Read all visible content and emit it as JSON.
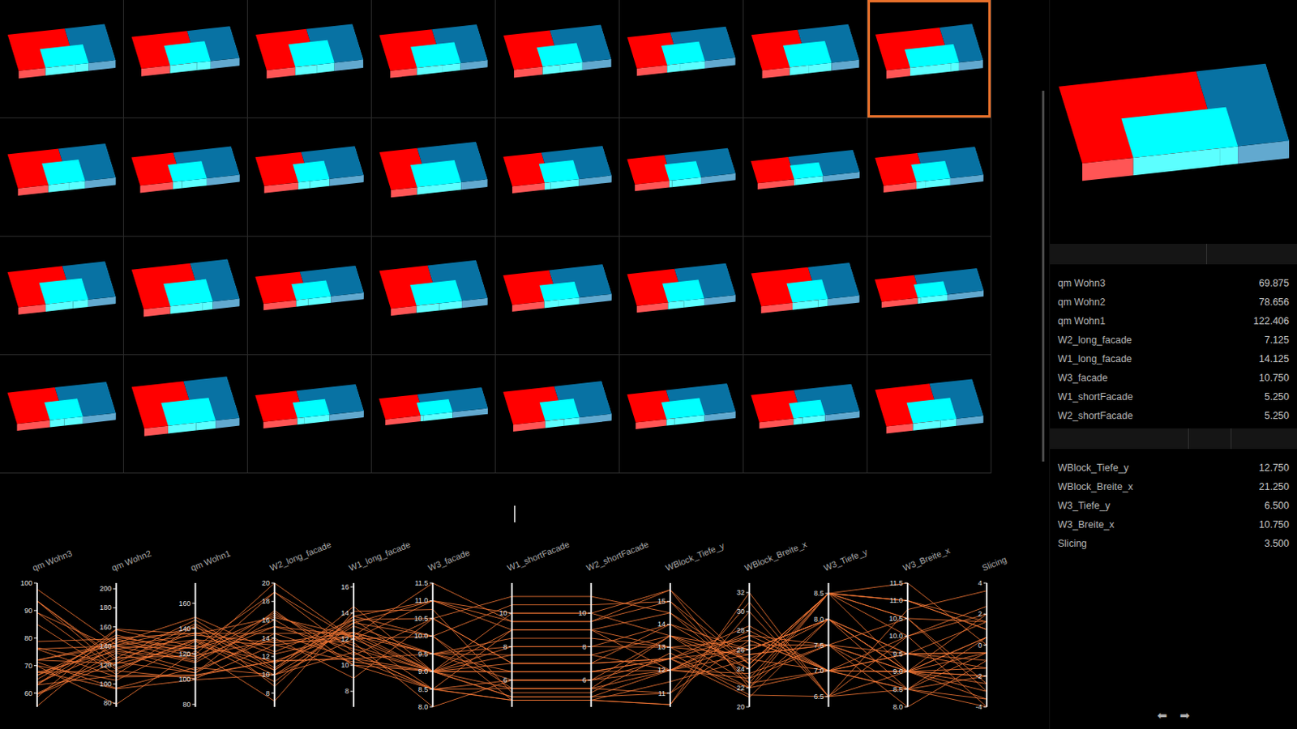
{
  "designs": [
    {
      "selected": false,
      "values": [
        70,
        103.9,
        129.9,
        9.25,
        13.25,
        10,
        5.5,
        5.5,
        13.5,
        22.5,
        7,
        10,
        2
      ]
    },
    {
      "selected": false,
      "values": [
        71.25,
        95.6,
        109.1,
        10,
        13,
        9.5,
        7.5,
        7.5,
        12,
        23,
        7.5,
        9.5,
        1.5
      ]
    },
    {
      "selected": false,
      "values": [
        68,
        95,
        99.5,
        10,
        11,
        8.5,
        6,
        6,
        12.5,
        21,
        8,
        8.5,
        0.5
      ]
    },
    {
      "selected": false,
      "values": [
        93.5,
        124.8,
        136.9,
        11.25,
        13.25,
        11,
        9,
        9,
        14.5,
        24.5,
        8.5,
        11,
        1
      ]
    },
    {
      "selected": false,
      "values": [
        63,
        108.8,
        103.3,
        11.5,
        10.5,
        9,
        6.5,
        6.5,
        12.5,
        22,
        7,
        9,
        -0.5
      ]
    },
    {
      "selected": false,
      "values": [
        67.5,
        114,
        100.5,
        13.25,
        10.25,
        9,
        5,
        5,
        12,
        23.5,
        7.5,
        9,
        -1.5
      ]
    },
    {
      "selected": false,
      "values": [
        76,
        107.5,
        102.5,
        11.5,
        10.5,
        9.5,
        8,
        8,
        13,
        22,
        8,
        9.5,
        -0.5
      ]
    },
    {
      "selected": true,
      "values": [
        69.875,
        78.656,
        122.406,
        7.125,
        14.125,
        10.75,
        5.25,
        5.25,
        12.75,
        21.25,
        6.5,
        10.75,
        3.5
      ]
    },
    {
      "selected": false,
      "values": [
        76.5,
        121.3,
        126.3,
        11.5,
        12.5,
        9,
        10,
        10,
        13.5,
        24,
        8.5,
        9,
        0.5
      ]
    },
    {
      "selected": false,
      "values": [
        59.5,
        123,
        105,
        14.5,
        10.5,
        8.5,
        4.8,
        4.8,
        11.5,
        25,
        7,
        8.5,
        -2
      ]
    },
    {
      "selected": false,
      "values": [
        60,
        127.5,
        118.5,
        13.75,
        11.75,
        8,
        6,
        6,
        12,
        25.5,
        7.5,
        8,
        -1
      ]
    },
    {
      "selected": false,
      "values": [
        89.25,
        137.1,
        107.1,
        14,
        9,
        10.5,
        11,
        11,
        14.5,
        23,
        8.5,
        10.5,
        -2.5
      ]
    },
    {
      "selected": false,
      "values": [
        72,
        140,
        113,
        16,
        10,
        9,
        7,
        7,
        12.5,
        26,
        8,
        9,
        -3
      ]
    },
    {
      "selected": false,
      "values": [
        59.5,
        132.7,
        104.8,
        17,
        10,
        8.5,
        5.5,
        5.5,
        11,
        27,
        7,
        8.5,
        -3.5
      ]
    },
    {
      "selected": false,
      "values": [
        55.25,
        145.9,
        113.9,
        19,
        11,
        8.5,
        4.8,
        4.8,
        10.5,
        30,
        6.5,
        8.5,
        -4
      ]
    },
    {
      "selected": false,
      "values": [
        67.5,
        134.3,
        116.2,
        15.25,
        11.25,
        9,
        9,
        9,
        12,
        26.5,
        7.5,
        9,
        -2
      ]
    },
    {
      "selected": false,
      "values": [
        89.25,
        115.1,
        131.6,
        10.5,
        13.5,
        10.5,
        7,
        7,
        14,
        24,
        8.5,
        10.5,
        1.5
      ]
    },
    {
      "selected": false,
      "values": [
        85,
        110,
        142.5,
        8.75,
        13.75,
        10,
        10.5,
        10.5,
        15,
        22.5,
        8.5,
        10,
        2.5
      ]
    },
    {
      "selected": false,
      "values": [
        66.5,
        139.2,
        124.3,
        15.25,
        12.25,
        9.5,
        6.5,
        6.5,
        12,
        27.5,
        7,
        9.5,
        -1.5
      ]
    },
    {
      "selected": false,
      "values": [
        97.75,
        141,
        141,
        12.25,
        12.25,
        11.5,
        9.5,
        9.5,
        15.5,
        24.5,
        8.5,
        11.5,
        0
      ]
    },
    {
      "selected": false,
      "values": [
        66.5,
        148.3,
        136.2,
        14.5,
        12.5,
        9.5,
        8.5,
        8.5,
        13,
        27,
        7,
        9.5,
        -1
      ]
    },
    {
      "selected": false,
      "values": [
        76,
        140.2,
        134.8,
        13.5,
        12.5,
        9.5,
        6,
        6,
        13.5,
        26,
        8,
        9.5,
        -0.5
      ]
    },
    {
      "selected": false,
      "values": [
        72,
        121.8,
        143.8,
        10.5,
        14.5,
        9,
        7.5,
        7.5,
        13.5,
        25,
        8,
        9,
        2
      ]
    },
    {
      "selected": false,
      "values": [
        58.5,
        157,
        125.5,
        19,
        12,
        9,
        5,
        5,
        11,
        31,
        6.5,
        9,
        -3.5
      ]
    },
    {
      "selected": false,
      "values": [
        63.75,
        136.6,
        131.1,
        13.25,
        12.25,
        8.5,
        9,
        9,
        13,
        25.5,
        7.5,
        8.5,
        -0.5
      ]
    },
    {
      "selected": false,
      "values": [
        93.5,
        116.8,
        130.7,
        10,
        12,
        11,
        10,
        10,
        15.5,
        22,
        8.5,
        11,
        1
      ]
    },
    {
      "selected": false,
      "values": [
        63,
        149,
        124,
        16.5,
        11.5,
        9,
        5.5,
        5.5,
        12,
        28,
        7,
        9,
        -2.5
      ]
    },
    {
      "selected": false,
      "values": [
        65,
        151.5,
        119.5,
        20,
        12,
        10,
        4.8,
        4.8,
        10.5,
        32,
        6.5,
        10,
        -4
      ]
    },
    {
      "selected": false,
      "values": [
        72,
        143,
        149,
        12.5,
        13.5,
        9,
        8,
        8,
        14,
        26,
        8,
        9,
        0.5
      ]
    },
    {
      "selected": false,
      "values": [
        78.75,
        147.5,
        117.5,
        16.75,
        10.75,
        10.5,
        7,
        7,
        12.5,
        27.5,
        7.5,
        10.5,
        -3
      ]
    },
    {
      "selected": false,
      "values": [
        63,
        157.6,
        135.6,
        16.25,
        12.25,
        9,
        6.5,
        6.5,
        12.5,
        28.5,
        7,
        9,
        -2
      ]
    },
    {
      "selected": false,
      "values": [
        93.5,
        127.3,
        146.8,
        10.75,
        13.75,
        11,
        9.5,
        9.5,
        15,
        24.5,
        8.5,
        11,
        1.5
      ]
    }
  ],
  "details": {
    "outputs": [
      {
        "label": "qm Wohn3",
        "value": "69.875"
      },
      {
        "label": "qm Wohn2",
        "value": "78.656"
      },
      {
        "label": "qm Wohn1",
        "value": "122.406"
      },
      {
        "label": "W2_long_facade",
        "value": "7.125"
      },
      {
        "label": "W1_long_facade",
        "value": "14.125"
      },
      {
        "label": "W3_facade",
        "value": "10.750"
      },
      {
        "label": "W1_shortFacade",
        "value": "5.250"
      },
      {
        "label": "W2_shortFacade",
        "value": "5.250"
      }
    ],
    "inputs": [
      {
        "label": "WBlock_Tiefe_y",
        "value": "12.750"
      },
      {
        "label": "WBlock_Breite_x",
        "value": "21.250"
      },
      {
        "label": "W3_Tiefe_y",
        "value": "6.500"
      },
      {
        "label": "W3_Breite_x",
        "value": "10.750"
      },
      {
        "label": "Slicing",
        "value": "3.500"
      }
    ]
  },
  "nav": {
    "prev": "⬅",
    "next": "➡"
  },
  "chart": {
    "axes": [
      {
        "label": "qm Wohn3",
        "min": 55,
        "max": 100,
        "ticks": [
          "60",
          "70",
          "80",
          "90",
          "100"
        ]
      },
      {
        "label": "qm Wohn2",
        "min": 76,
        "max": 206,
        "ticks": [
          "80",
          "100",
          "120",
          "140",
          "160",
          "180",
          "200"
        ]
      },
      {
        "label": "qm Wohn1",
        "min": 78,
        "max": 176,
        "ticks": [
          "80",
          "100",
          "120",
          "140",
          "160"
        ]
      },
      {
        "label": "W2_long_facade",
        "min": 6.5,
        "max": 20,
        "ticks": [
          "8",
          "10",
          "12",
          "14",
          "16",
          "18",
          "20"
        ]
      },
      {
        "label": "W1_long_facade",
        "min": 6.8,
        "max": 16.3,
        "ticks": [
          "8",
          "10",
          "12",
          "14",
          "16"
        ]
      },
      {
        "label": "W3_facade",
        "min": 8,
        "max": 11.5,
        "ticks": [
          "8.0",
          "8.5",
          "9.0",
          "9.5",
          "10.0",
          "10.5",
          "11.0",
          "11.5"
        ]
      },
      {
        "label": "W1_shortFacade",
        "min": 4.4,
        "max": 11.8,
        "ticks": [
          "6",
          "8",
          "10"
        ]
      },
      {
        "label": "W2_shortFacade",
        "min": 4.4,
        "max": 11.8,
        "ticks": [
          "6",
          "8",
          "10"
        ]
      },
      {
        "label": "WBlock_Tiefe_y",
        "min": 10.4,
        "max": 15.8,
        "ticks": [
          "11",
          "12",
          "13",
          "14",
          "15"
        ]
      },
      {
        "label": "WBlock_Breite_x",
        "min": 20,
        "max": 33,
        "ticks": [
          "20",
          "22",
          "24",
          "26",
          "28",
          "30",
          "32"
        ]
      },
      {
        "label": "W3_Tiefe_y",
        "min": 6.3,
        "max": 8.7,
        "ticks": [
          "6.5",
          "7.0",
          "7.5",
          "8.0",
          "8.5"
        ]
      },
      {
        "label": "W3_Breite_x",
        "min": 8,
        "max": 11.5,
        "ticks": [
          "8.0",
          "8.5",
          "9.0",
          "9.5",
          "10.0",
          "10.5",
          "11.0",
          "11.5"
        ]
      },
      {
        "label": "Slicing",
        "min": -4,
        "max": 4,
        "ticks": [
          "-4",
          "-2",
          "0",
          "2",
          "4"
        ]
      }
    ]
  }
}
